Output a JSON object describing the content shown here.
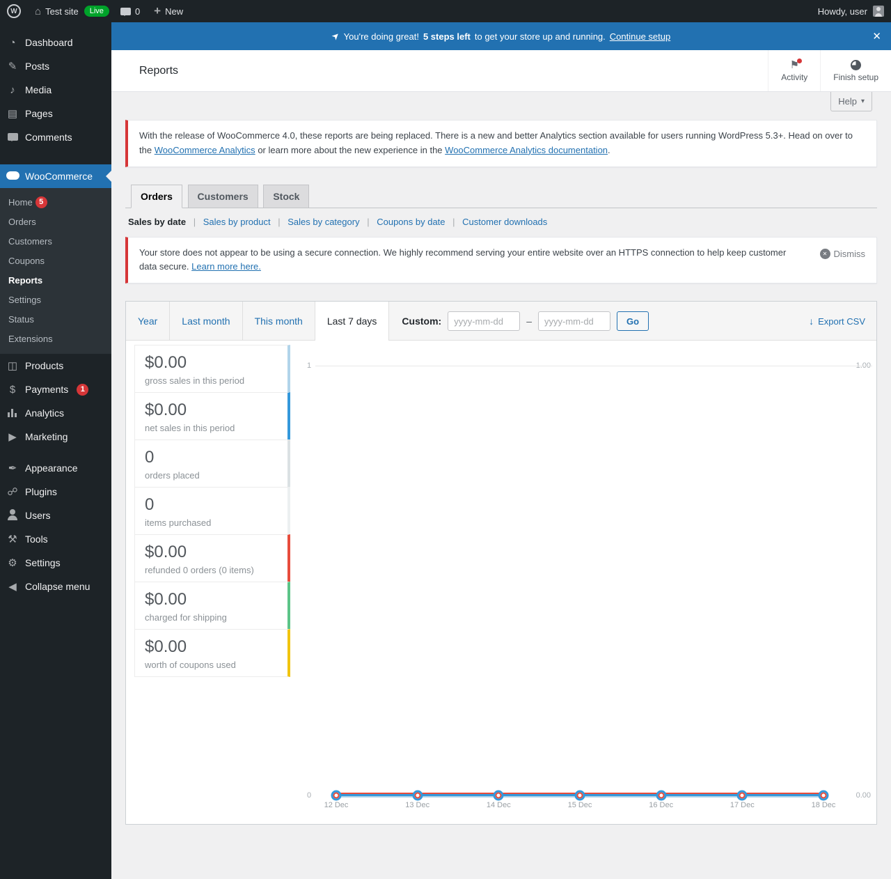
{
  "icons": {
    "wp": "W",
    "home": "⌂",
    "dashboard": "◔",
    "posts": "✎",
    "media": "♪",
    "pages": "▤",
    "products": "◫",
    "payments": "$",
    "marketing": "▶",
    "appearance": "✒",
    "plugins": "☍",
    "tools": "⚒",
    "settings": "⚙",
    "collapse": "◀",
    "activity": "⚑",
    "export": "↓",
    "caret": "▾",
    "close": "✕",
    "rocket": "➤",
    "plus": "+",
    "dismiss": "✕"
  },
  "admin_bar": {
    "site_name": "Test site",
    "live_badge": "Live",
    "comment_count": "0",
    "new_label": "New",
    "howdy_text": "Howdy, user"
  },
  "sidebar": {
    "top_items": [
      {
        "label": "Dashboard"
      },
      {
        "label": "Posts"
      },
      {
        "label": "Media"
      },
      {
        "label": "Pages"
      },
      {
        "label": "Comments"
      }
    ],
    "woocommerce": {
      "label": "WooCommerce",
      "submenu": [
        {
          "label": "Home",
          "badge": "5"
        },
        {
          "label": "Orders"
        },
        {
          "label": "Customers"
        },
        {
          "label": "Coupons"
        },
        {
          "label": "Reports"
        },
        {
          "label": "Settings"
        },
        {
          "label": "Status"
        },
        {
          "label": "Extensions"
        }
      ]
    },
    "mid_items": [
      {
        "label": "Products"
      },
      {
        "label": "Payments",
        "badge": "1"
      },
      {
        "label": "Analytics"
      },
      {
        "label": "Marketing"
      }
    ],
    "bottom_items": [
      {
        "label": "Appearance"
      },
      {
        "label": "Plugins"
      },
      {
        "label": "Users"
      },
      {
        "label": "Tools"
      },
      {
        "label": "Settings"
      }
    ],
    "collapse_label": "Collapse menu"
  },
  "setup_banner": {
    "lead": "You're doing great!",
    "bold": "5 steps left",
    "rest": "to get your store up and running.",
    "link": "Continue setup"
  },
  "header": {
    "title": "Reports",
    "activity_label": "Activity",
    "finish_setup_label": "Finish setup",
    "help_label": "Help"
  },
  "analytics_notice": {
    "text_1": "With the release of WooCommerce 4.0, these reports are being replaced. There is a new and better Analytics section available for users running WordPress 5.3+. Head on over to the",
    "link_1": "WooCommerce Analytics",
    "text_2": "or learn more about the new experience in the",
    "link_2": "WooCommerce Analytics documentation",
    "text_3": "."
  },
  "report_tabs": [
    {
      "label": "Orders"
    },
    {
      "label": "Customers"
    },
    {
      "label": "Stock"
    }
  ],
  "subnav_separator": "|",
  "report_subnav": [
    {
      "label": "Sales by date"
    },
    {
      "label": "Sales by product"
    },
    {
      "label": "Sales by category"
    },
    {
      "label": "Coupons by date"
    },
    {
      "label": "Customer downloads"
    }
  ],
  "https_notice": {
    "text": "Your store does not appear to be using a secure connection. We highly recommend serving your entire website over an HTTPS connection to help keep customer data secure.",
    "link": "Learn more here.",
    "dismiss_label": "Dismiss"
  },
  "range_filter": {
    "ranges": [
      "Year",
      "Last month",
      "This month",
      "Last 7 days"
    ],
    "active_range": "Last 7 days",
    "custom_label": "Custom:",
    "date_placeholder": "yyyy-mm-dd",
    "separator": "–",
    "go_label": "Go",
    "export_label": "Export CSV"
  },
  "stats": [
    {
      "value": "$0.00",
      "label": "gross sales in this period",
      "color": "#b1d4ea"
    },
    {
      "value": "$0.00",
      "label": "net sales in this period",
      "color": "#3498db"
    },
    {
      "value": "0",
      "label": "orders placed",
      "color": "#dbe1e3"
    },
    {
      "value": "0",
      "label": "items purchased",
      "color": "#ecf0f1"
    },
    {
      "value": "$0.00",
      "label": "refunded 0 orders (0 items)",
      "color": "#e74c3c"
    },
    {
      "value": "$0.00",
      "label": "charged for shipping",
      "color": "#5cc488"
    },
    {
      "value": "$0.00",
      "label": "worth of coupons used",
      "color": "#f1c40f"
    }
  ],
  "chart_data": {
    "type": "line",
    "x": [
      "12 Dec",
      "13 Dec",
      "14 Dec",
      "15 Dec",
      "16 Dec",
      "17 Dec",
      "18 Dec"
    ],
    "series": [
      {
        "name": "gross sales",
        "color": "#b1d4ea",
        "values": [
          0,
          0,
          0,
          0,
          0,
          0,
          0
        ]
      },
      {
        "name": "net sales",
        "color": "#3498db",
        "values": [
          0,
          0,
          0,
          0,
          0,
          0,
          0
        ]
      },
      {
        "name": "refunds",
        "color": "#e74c3c",
        "values": [
          0,
          0,
          0,
          0,
          0,
          0,
          0
        ]
      }
    ],
    "y_left": {
      "top": "1",
      "bottom": "0"
    },
    "y_right": {
      "top": "1.00",
      "bottom": "0.00"
    },
    "grid": "top-line-only",
    "legend_position": "left-column"
  }
}
